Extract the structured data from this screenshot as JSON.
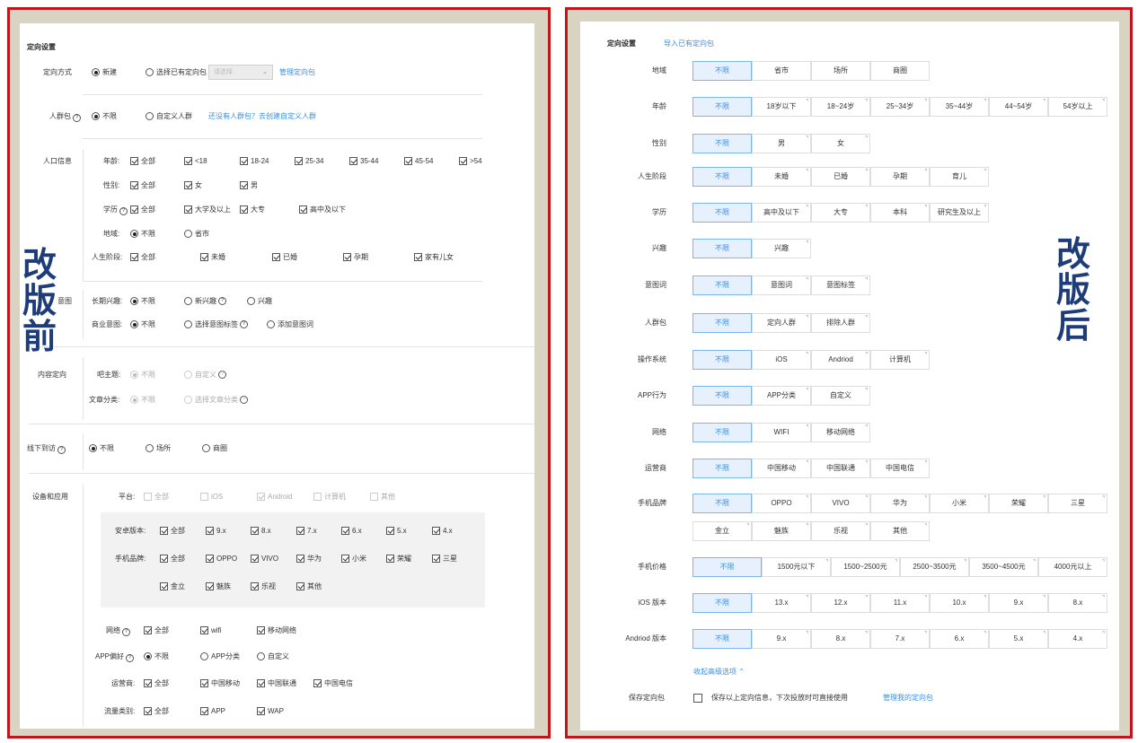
{
  "before": {
    "big_label": "改版前",
    "title": "定向设置",
    "mode": {
      "label": "定向方式",
      "new": "新建",
      "select": "选择已有定向包",
      "select_placeholder": "请选择",
      "manage": "管理定向包"
    },
    "crowd": {
      "label": "人群包",
      "unlimited": "不限",
      "custom": "自定义人群",
      "hint": "还没有人群包？去创建自定义人群"
    },
    "demo": {
      "label": "人口信息",
      "age": {
        "label": "年龄:",
        "opts": [
          "全部",
          "<18",
          "18-24",
          "25-34",
          "35-44",
          "45-54",
          ">54"
        ]
      },
      "gender": {
        "label": "性别:",
        "opts": [
          "全部",
          "女",
          "男"
        ]
      },
      "edu": {
        "label": "学历",
        "opts": [
          "全部",
          "大学及以上",
          "大专",
          "高中及以下"
        ]
      },
      "region": {
        "label": "地域:",
        "opts": [
          "不限",
          "省市"
        ]
      },
      "life": {
        "label": "人生阶段:",
        "opts": [
          "全部",
          "未婚",
          "已婚",
          "孕期",
          "家有儿女"
        ]
      }
    },
    "intent": {
      "label": "意图",
      "long": {
        "label": "长期兴趣:",
        "opts": [
          "不限",
          "新兴趣",
          "兴趣"
        ]
      },
      "biz": {
        "label": "商业意图:",
        "opts": [
          "不限",
          "选择意图标签",
          "添加意图词"
        ]
      }
    },
    "content": {
      "label": "内容定向",
      "topic": {
        "label": "吧主题:",
        "opts": [
          "不限",
          "自定义"
        ]
      },
      "cat": {
        "label": "文章分类:",
        "opts": [
          "不限",
          "选择文章分类"
        ]
      }
    },
    "offline": {
      "label": "线下到访",
      "opts": [
        "不限",
        "场所",
        "商圈"
      ]
    },
    "device": {
      "label": "设备和应用",
      "platform": {
        "label": "平台:",
        "opts": [
          "全部",
          "iOS",
          "Android",
          "计算机",
          "其他"
        ]
      },
      "android": {
        "label": "安卓版本:",
        "opts": [
          "全部",
          "9.x",
          "8.x",
          "7.x",
          "6.x",
          "5.x",
          "4.x"
        ]
      },
      "brand": {
        "label": "手机品牌:",
        "opts": [
          "全部",
          "OPPO",
          "VIVO",
          "华为",
          "小米",
          "荣耀",
          "三星"
        ],
        "opts2": [
          "金立",
          "魅族",
          "乐视",
          "其他"
        ]
      },
      "network": {
        "label": "网络",
        "opts": [
          "全部",
          "wifi",
          "移动网络"
        ]
      },
      "app": {
        "label": "APP偏好",
        "opts": [
          "不限",
          "APP分类",
          "自定义"
        ]
      },
      "carrier": {
        "label": "运营商:",
        "opts": [
          "全部",
          "中国移动",
          "中国联通",
          "中国电信"
        ]
      },
      "traffic": {
        "label": "流量类别:",
        "opts": [
          "全部",
          "APP",
          "WAP"
        ]
      }
    }
  },
  "after": {
    "big_label": "改版后",
    "title": "定向设置",
    "import_link": "导入已有定向包",
    "rows": [
      {
        "label": "地域",
        "opts": [
          "不限",
          "省市",
          "场所",
          "商圈"
        ]
      },
      {
        "label": "年龄",
        "opts": [
          "不限",
          "18岁以下",
          "18~24岁",
          "25~34岁",
          "35~44岁",
          "44~54岁",
          "54岁以上"
        ]
      },
      {
        "label": "性别",
        "opts": [
          "不限",
          "男",
          "女"
        ]
      },
      {
        "label": "人生阶段",
        "opts": [
          "不限",
          "未婚",
          "已婚",
          "孕期",
          "育儿"
        ]
      },
      {
        "label": "学历",
        "opts": [
          "不限",
          "高中及以下",
          "大专",
          "本科",
          "研究生及以上"
        ]
      },
      {
        "label": "兴趣",
        "opts": [
          "不限",
          "兴趣"
        ]
      },
      {
        "label": "意图词",
        "opts": [
          "不限",
          "意图词",
          "意图标签"
        ]
      },
      {
        "label": "人群包",
        "opts": [
          "不限",
          "定向人群",
          "排除人群"
        ]
      },
      {
        "label": "操作系统",
        "opts": [
          "不限",
          "iOS",
          "Andriod",
          "计算机"
        ]
      },
      {
        "label": "APP行为",
        "opts": [
          "不限",
          "APP分类",
          "自定义"
        ]
      },
      {
        "label": "网络",
        "opts": [
          "不限",
          "WIFI",
          "移动网络"
        ]
      },
      {
        "label": "运营商",
        "opts": [
          "不限",
          "中国移动",
          "中国联通",
          "中国电信"
        ]
      },
      {
        "label": "手机品牌",
        "opts": [
          "不限",
          "OPPO",
          "VIVO",
          "华为",
          "小米",
          "荣耀",
          "三星"
        ],
        "opts2": [
          "金立",
          "魅族",
          "乐视",
          "其他"
        ]
      },
      {
        "label": "手机价格",
        "opts": [
          "不限",
          "1500元以下",
          "1500~2500元",
          "2500~3500元",
          "3500~4500元",
          "4000元以上"
        ]
      },
      {
        "label": "iOS 版本",
        "opts": [
          "不限",
          "13.x",
          "12.x",
          "11.x",
          "10.x",
          "9.x",
          "8.x"
        ]
      },
      {
        "label": "Andriod 版本",
        "opts": [
          "不限",
          "9.x",
          "8.x",
          "7.x",
          "6.x",
          "5.x",
          "4.x"
        ]
      }
    ],
    "collapse": "收起高级选项",
    "save": {
      "label": "保存定向包",
      "text": "保存以上定向信息，下次投放时可直接使用",
      "link": "管理我的定向包"
    }
  }
}
